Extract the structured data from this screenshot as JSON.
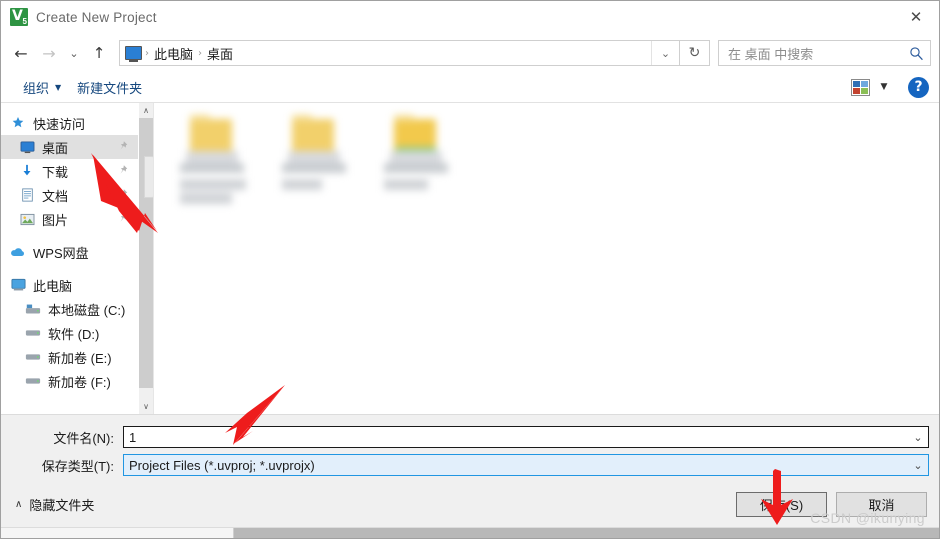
{
  "window": {
    "title": "Create New Project",
    "app_icon": "keil-uvision-icon",
    "icon_letter": "V",
    "icon_sub": "5",
    "close_label": "✕"
  },
  "navbar": {
    "back": "←",
    "forward": "→",
    "history": "⌄",
    "up": "↑",
    "breadcrumb": {
      "root_icon": "this-pc-monitor-icon",
      "items": [
        "此电脑",
        "桌面"
      ],
      "separator": "›"
    },
    "address_chevron": "⌄",
    "refresh": "↻",
    "search_placeholder": "在 桌面 中搜索"
  },
  "cmdbar": {
    "organize": "组织",
    "organize_caret": "▼",
    "new_folder": "新建文件夹",
    "view_caret": "▼",
    "help": "?"
  },
  "sidebar": {
    "items": [
      {
        "label": "快速访问",
        "icon": "quick-access-star-icon",
        "level": 0,
        "selected": false,
        "pinned": false
      },
      {
        "label": "桌面",
        "icon": "desktop-icon",
        "level": 1,
        "selected": true,
        "pinned": true
      },
      {
        "label": "下载",
        "icon": "downloads-arrow-icon",
        "level": 1,
        "selected": false,
        "pinned": true
      },
      {
        "label": "文档",
        "icon": "documents-icon",
        "level": 1,
        "selected": false,
        "pinned": true
      },
      {
        "label": "图片",
        "icon": "pictures-icon",
        "level": 1,
        "selected": false,
        "pinned": true
      },
      {
        "label": "WPS网盘",
        "icon": "cloud-icon",
        "level": 0,
        "selected": false,
        "pinned": false
      },
      {
        "label": "此电脑",
        "icon": "this-pc-icon",
        "level": 0,
        "selected": false,
        "pinned": false
      },
      {
        "label": "本地磁盘 (C:)",
        "icon": "local-disk-icon",
        "level": 2,
        "selected": false,
        "pinned": false
      },
      {
        "label": "软件 (D:)",
        "icon": "drive-icon",
        "level": 2,
        "selected": false,
        "pinned": false
      },
      {
        "label": "新加卷 (E:)",
        "icon": "drive-icon",
        "level": 2,
        "selected": false,
        "pinned": false
      },
      {
        "label": "新加卷 (F:)",
        "icon": "drive-icon",
        "level": 2,
        "selected": false,
        "pinned": false
      }
    ],
    "pin_glyph": "📌",
    "scroll_up": "∧",
    "scroll_down": "∨"
  },
  "content": {
    "items": [
      {
        "name": "",
        "blurred": true
      },
      {
        "name": "",
        "blurred": true
      },
      {
        "name": "",
        "blurred": true
      }
    ]
  },
  "form": {
    "filename_label": "文件名(N):",
    "filename_value": "1",
    "filetype_label": "保存类型(T):",
    "filetype_value": "Project Files (*.uvproj; *.uvprojx)",
    "chevron": "⌄"
  },
  "footer": {
    "hide_folders": "隐藏文件夹",
    "hide_caret": "∧",
    "save_label": "保存(S)",
    "cancel_label": "取消",
    "watermark": "CSDN @ikunying"
  },
  "colors": {
    "accent_blue": "#2196e2",
    "link_blue": "#15477e",
    "help_blue": "#1565c0",
    "annotation_red": "#ee1c1c",
    "selection_gray": "#e0e0e0",
    "app_green": "#2e9443"
  }
}
